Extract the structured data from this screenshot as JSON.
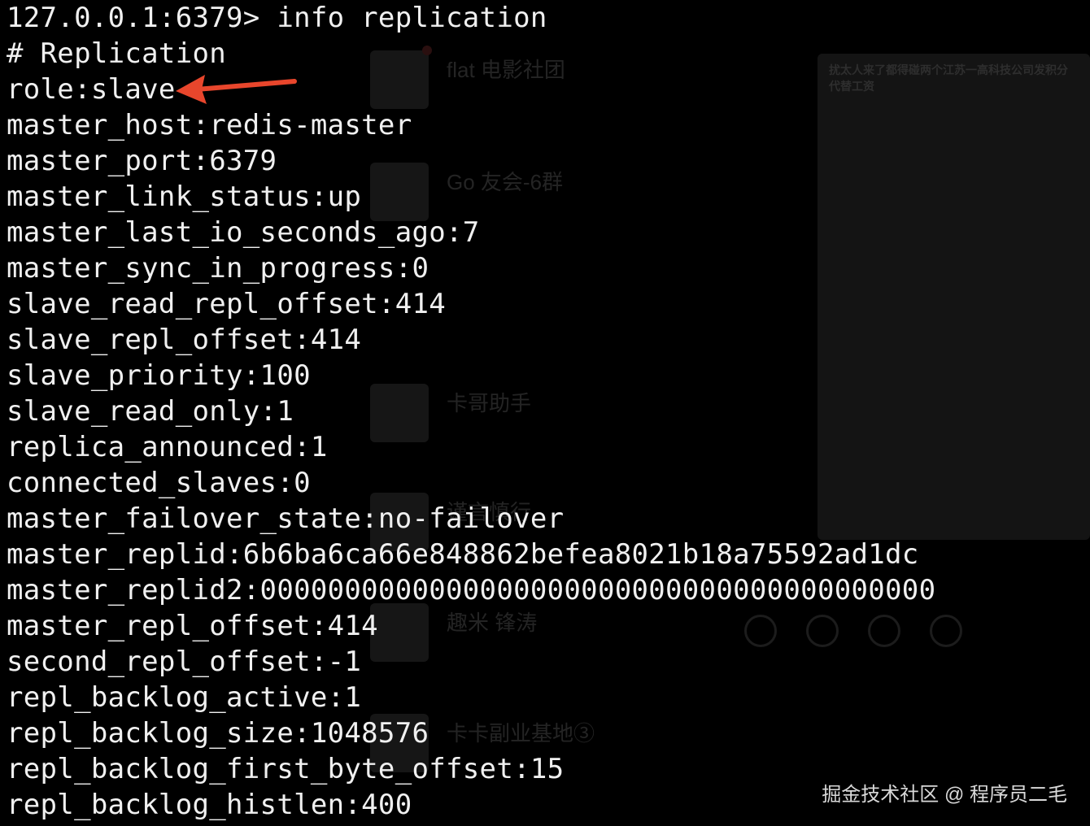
{
  "terminal": {
    "lines": [
      "127.0.0.1:6379> info replication",
      "# Replication",
      "role:slave",
      "master_host:redis-master",
      "master_port:6379",
      "master_link_status:up",
      "master_last_io_seconds_ago:7",
      "master_sync_in_progress:0",
      "slave_read_repl_offset:414",
      "slave_repl_offset:414",
      "slave_priority:100",
      "slave_read_only:1",
      "replica_announced:1",
      "connected_slaves:0",
      "master_failover_state:no-failover",
      "master_replid:6b6ba6ca66e848862befea8021b18a75592ad1dc",
      "master_replid2:0000000000000000000000000000000000000000",
      "master_repl_offset:414",
      "second_repl_offset:-1",
      "repl_backlog_active:1",
      "repl_backlog_size:1048576",
      "repl_backlog_first_byte_offset:15",
      "repl_backlog_histlen:400"
    ]
  },
  "annotation": {
    "arrow_color": "#e8462c",
    "points_to": "role:slave"
  },
  "background": {
    "chats": [
      "flat 电影社团",
      "Go 友会-6群",
      "卡哥助手",
      "谨言慎行",
      "趣米 锋涛",
      "卡卡副业基地③"
    ],
    "panel_title": "扰太人来了都得碰两个江苏一高科技公司发积分代替工资"
  },
  "watermark": {
    "text": "掘金技术社区 @ 程序员二毛"
  }
}
